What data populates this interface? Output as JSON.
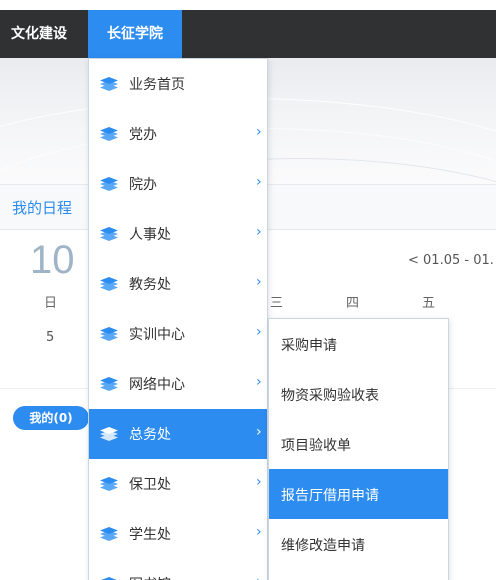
{
  "colors": {
    "accent": "#2d8cf0",
    "nav_bg": "#2f3133",
    "menu_border": "#c9d6e3"
  },
  "nav": {
    "items": [
      {
        "label": "文化建设"
      },
      {
        "label": "长征学院"
      }
    ]
  },
  "schedule": {
    "title": "我的日程",
    "big_day": "10",
    "weekday": "日",
    "day_number": "5",
    "week_range": "<   01.05 - 01.",
    "week_days": [
      "三",
      "四",
      "五"
    ],
    "my_label": "我的(0)"
  },
  "menu": {
    "items": [
      {
        "label": "业务首页",
        "icon": "stack-icon",
        "has_submenu": false
      },
      {
        "label": "党办",
        "icon": "stack-icon",
        "has_submenu": true
      },
      {
        "label": "院办",
        "icon": "stack-icon",
        "has_submenu": true
      },
      {
        "label": "人事处",
        "icon": "stack-icon",
        "has_submenu": true
      },
      {
        "label": "教务处",
        "icon": "stack-icon",
        "has_submenu": true
      },
      {
        "label": "实训中心",
        "icon": "stack-icon",
        "has_submenu": true
      },
      {
        "label": "网络中心",
        "icon": "stack-icon",
        "has_submenu": true
      },
      {
        "label": "总务处",
        "icon": "stack-icon",
        "has_submenu": true,
        "active": true
      },
      {
        "label": "保卫处",
        "icon": "stack-icon",
        "has_submenu": true
      },
      {
        "label": "学生处",
        "icon": "stack-icon",
        "has_submenu": true
      },
      {
        "label": "图书馆",
        "icon": "stack-icon",
        "has_submenu": true
      }
    ],
    "chevron": "›"
  },
  "submenu": {
    "items": [
      {
        "label": "采购申请"
      },
      {
        "label": "物资采购验收表"
      },
      {
        "label": "项目验收单"
      },
      {
        "label": "报告厅借用申请",
        "active": true
      },
      {
        "label": "维修改造申请"
      }
    ]
  }
}
